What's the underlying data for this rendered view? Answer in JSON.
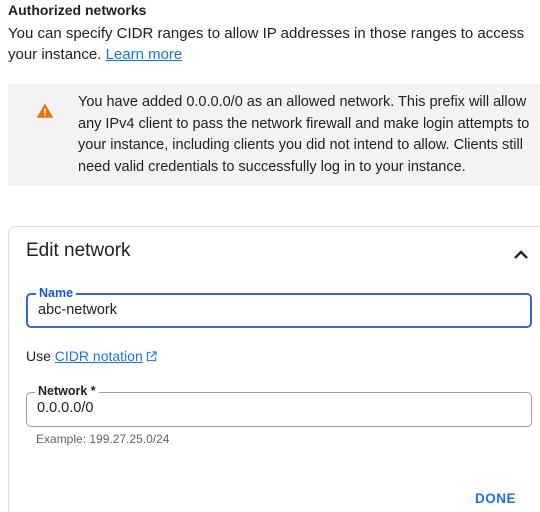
{
  "section": {
    "title": "Authorized networks",
    "description": "You can specify CIDR ranges to allow IP addresses in those ranges to access your instance.",
    "learn_more": "Learn more"
  },
  "warning": {
    "icon": "warning-icon",
    "icon_color": "#e8710a",
    "text": "You have added 0.0.0.0/0 as an allowed network. This prefix will allow any IPv4 client to pass the network firewall and make login attempts to your instance, including clients you did not intend to allow. Clients still need valid credentials to successfully log in to your instance."
  },
  "edit_network": {
    "title": "Edit network",
    "collapse_icon": "chevron-up-icon",
    "name_field": {
      "label": "Name",
      "value": "abc-network"
    },
    "cidr_hint": {
      "prefix": "Use",
      "link": "CIDR notation",
      "icon": "open-in-new-icon"
    },
    "network_field": {
      "label": "Network *",
      "value": "0.0.0.0/0",
      "helper": "Example: 199.27.25.0/24"
    },
    "done_label": "DONE"
  },
  "colors": {
    "accent": "#1a73e8",
    "focus_border": "#3367d6",
    "warning_bg": "#f1f3f4"
  }
}
